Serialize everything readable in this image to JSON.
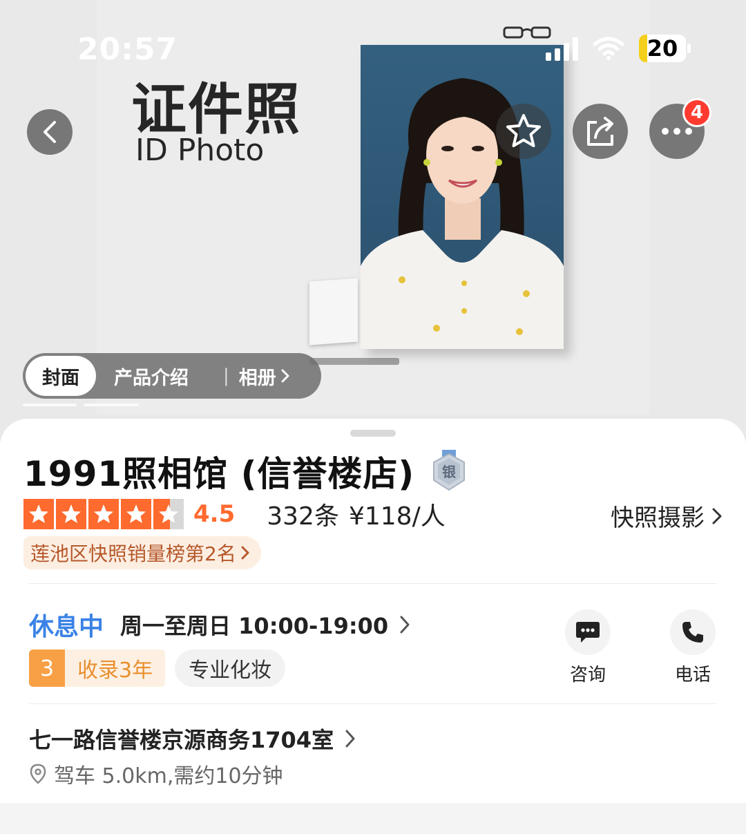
{
  "status_bar": {
    "time": "20:57",
    "battery": "20"
  },
  "hero": {
    "poster_title_cn": "证件照",
    "poster_title_en": "ID Photo",
    "notification_count": "4",
    "tabs": [
      {
        "label": "封面",
        "active": true
      },
      {
        "label": "产品介绍",
        "active": false
      },
      {
        "label": "相册",
        "active": false
      }
    ]
  },
  "shop": {
    "name": "1991照相馆 (信誉楼店)",
    "medal": "银",
    "rating": 4.5,
    "rating_text": "4.5",
    "reviews": "332条",
    "price": "¥118/人",
    "category": "快照摄影",
    "rank": "莲池区快照销量榜第2名",
    "status": "休息中",
    "hours": "周一至周日 10:00-19:00",
    "years_num": "3",
    "years_label": "收录3年",
    "tag": "专业化妆",
    "address": "七一路信誉楼京源商务1704室",
    "distance": "驾车 5.0km,需约10分钟"
  },
  "actions": [
    {
      "label": "咨询",
      "icon": "chat-icon"
    },
    {
      "label": "电话",
      "icon": "phone-icon"
    }
  ],
  "colors": {
    "accent": "#ff6a2e",
    "status_blue": "#3a82e6",
    "badge_red": "#ff3b2f"
  }
}
